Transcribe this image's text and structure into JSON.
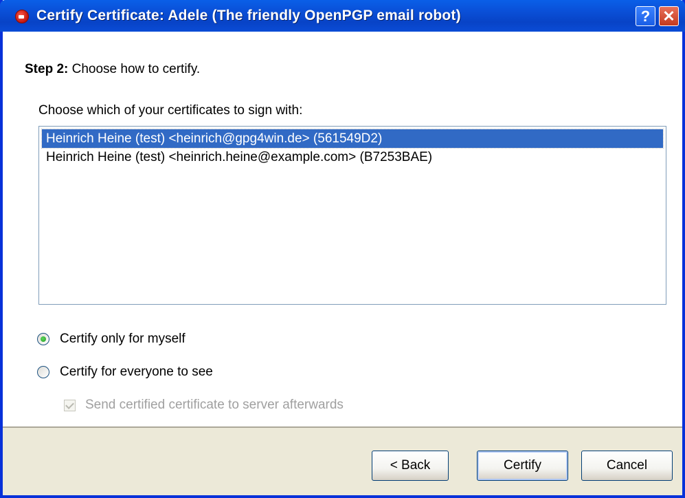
{
  "window": {
    "title": "Certify Certificate: Adele (The friendly OpenPGP email robot)",
    "help_label": "?",
    "close_label": "✕"
  },
  "step": {
    "prefix": "Step 2:",
    "text": " Choose how to certify."
  },
  "certificates": {
    "label": "Choose which of your certificates to sign with:",
    "items": [
      {
        "label": "Heinrich Heine (test) <heinrich@gpg4win.de> (561549D2)",
        "selected": true
      },
      {
        "label": "Heinrich Heine (test) <heinrich.heine@example.com> (B7253BAE)",
        "selected": false
      }
    ]
  },
  "options": {
    "self_label": "Certify only for myself",
    "everyone_label": "Certify for everyone to see",
    "selected": "self",
    "send_label": "Send certified certificate to server afterwards",
    "send_checked": true,
    "send_enabled": false
  },
  "buttons": {
    "back": "< Back",
    "certify": "Certify",
    "cancel": "Cancel"
  },
  "colors": {
    "titlebar": "#0a50d8",
    "selection": "#316ac5",
    "footer": "#ece9d8"
  }
}
